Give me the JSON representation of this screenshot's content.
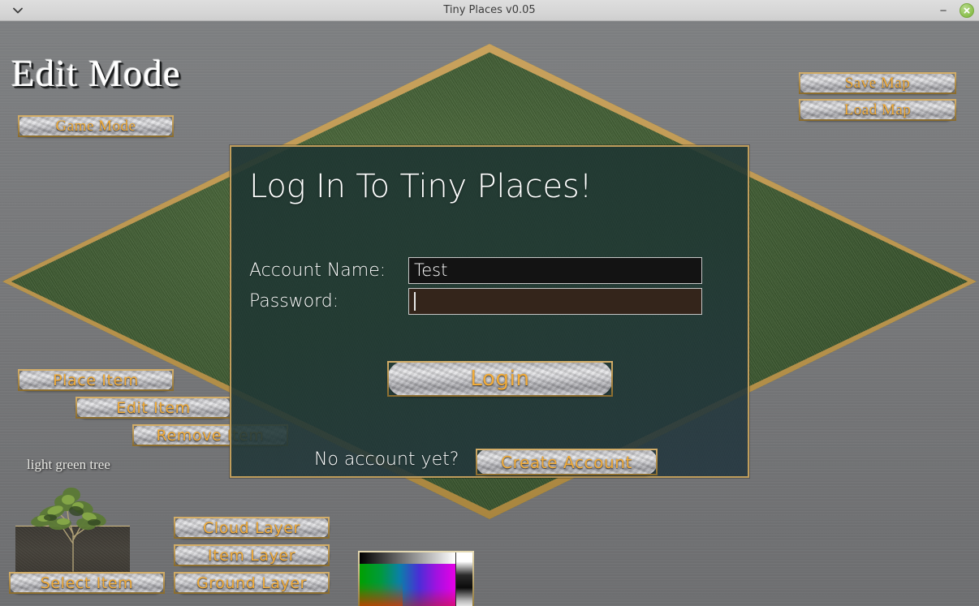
{
  "window": {
    "title": "Tiny Places v0.05",
    "menu_icon": "chevron-down-icon",
    "minimize_label": "−",
    "close_icon": "close-x-icon"
  },
  "hud": {
    "mode_title": "Edit Mode",
    "game_mode_button": "Game Mode",
    "save_map_button": "Save Map",
    "load_map_button": "Load Map",
    "place_item_button": "Place Item",
    "edit_item_button": "Edit Item",
    "remove_item_button": "Remove Item",
    "select_item_button": "Select Item",
    "cloud_layer_button": "Cloud Layer",
    "item_layer_button": "Item Layer",
    "ground_layer_button": "Ground Layer",
    "selected_item_label": "light green tree"
  },
  "login": {
    "title": "Log In To Tiny Places!",
    "account_label": "Account Name:",
    "account_value": "Test",
    "account_placeholder": "",
    "password_label": "Password:",
    "password_value": "",
    "password_placeholder": "",
    "login_button": "Login",
    "no_account_text": "No account yet?",
    "create_account_button": "Create Account"
  },
  "color_picker": {
    "name": "color-picker"
  },
  "colors": {
    "accent_gold": "#f0ab3a",
    "border_gold": "#bf9d5c",
    "panel_bg": "#1d3430",
    "grass": "#3f5c31",
    "metal_bg": "#78797b",
    "close_green": "#8cc04e"
  }
}
